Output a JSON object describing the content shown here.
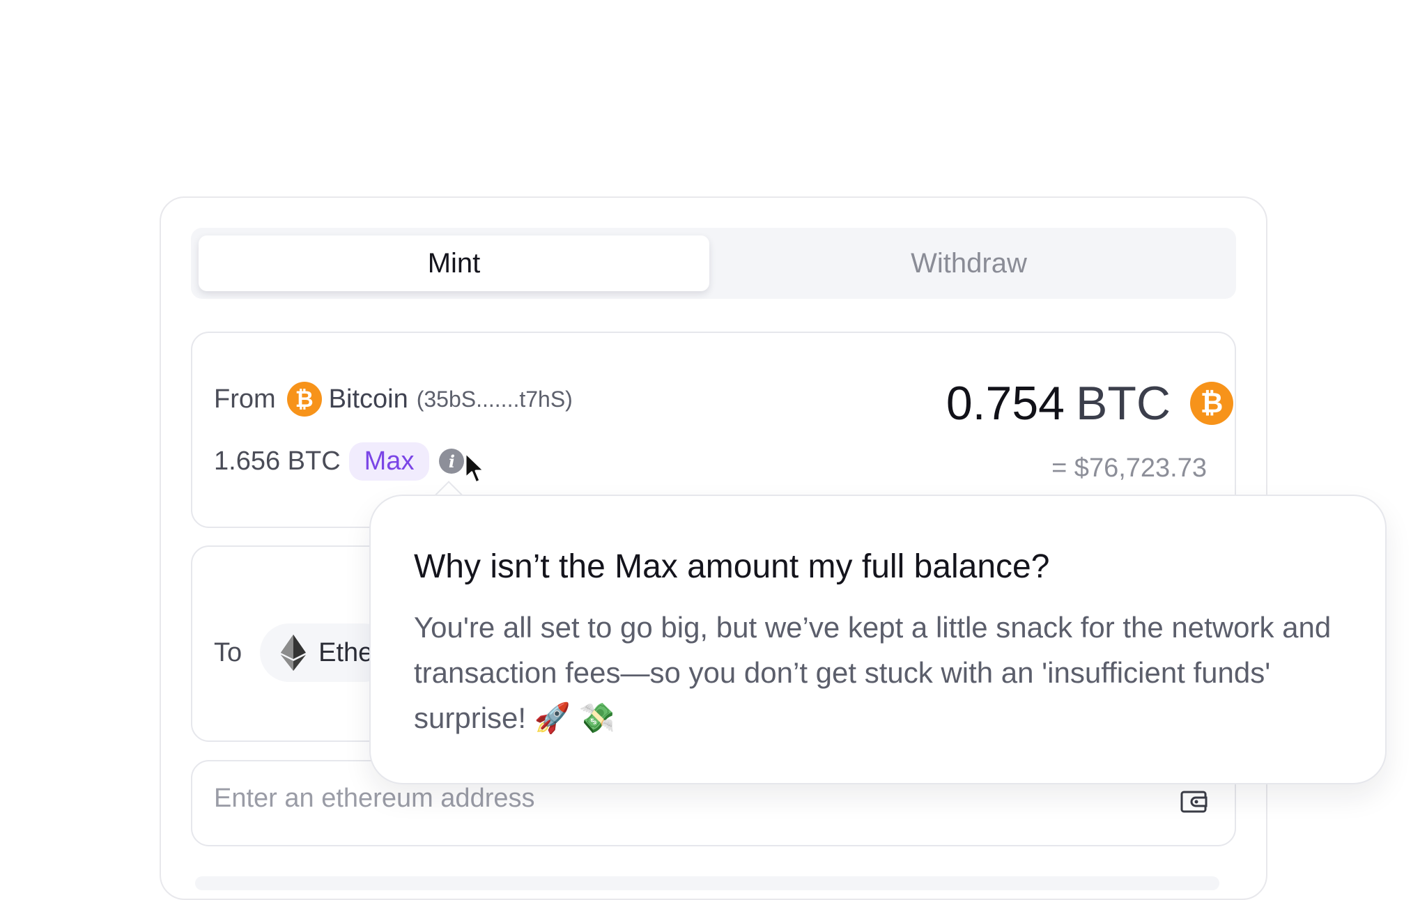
{
  "tabs": {
    "mint_label": "Mint",
    "withdraw_label": "Withdraw"
  },
  "from": {
    "label": "From",
    "coin_icon": "bitcoin-icon",
    "coin_glyph": "₿",
    "chain": "Bitcoin",
    "address": "(35bS.......t7hS)",
    "balance": "1.656 BTC",
    "max_label": "Max",
    "amount": "0.754",
    "unit": "BTC",
    "usd_value": "= $76,723.73"
  },
  "to": {
    "label": "To",
    "coin_icon": "ethereum-icon",
    "chain": "Ethe"
  },
  "address_input": {
    "placeholder": "Enter an ethereum address",
    "icon": "wallet-icon"
  },
  "tooltip": {
    "title": "Why isn’t the Max amount my full balance?",
    "body": "You're all set to go big, but we’ve kept a little snack for the network and transaction fees—so you don’t get stuck with an 'insufficient funds' surprise! 🚀 💸"
  },
  "colors": {
    "bitcoin": "#f7931a",
    "max_accent": "#7a45e6",
    "max_bg": "#f1ecfd"
  }
}
